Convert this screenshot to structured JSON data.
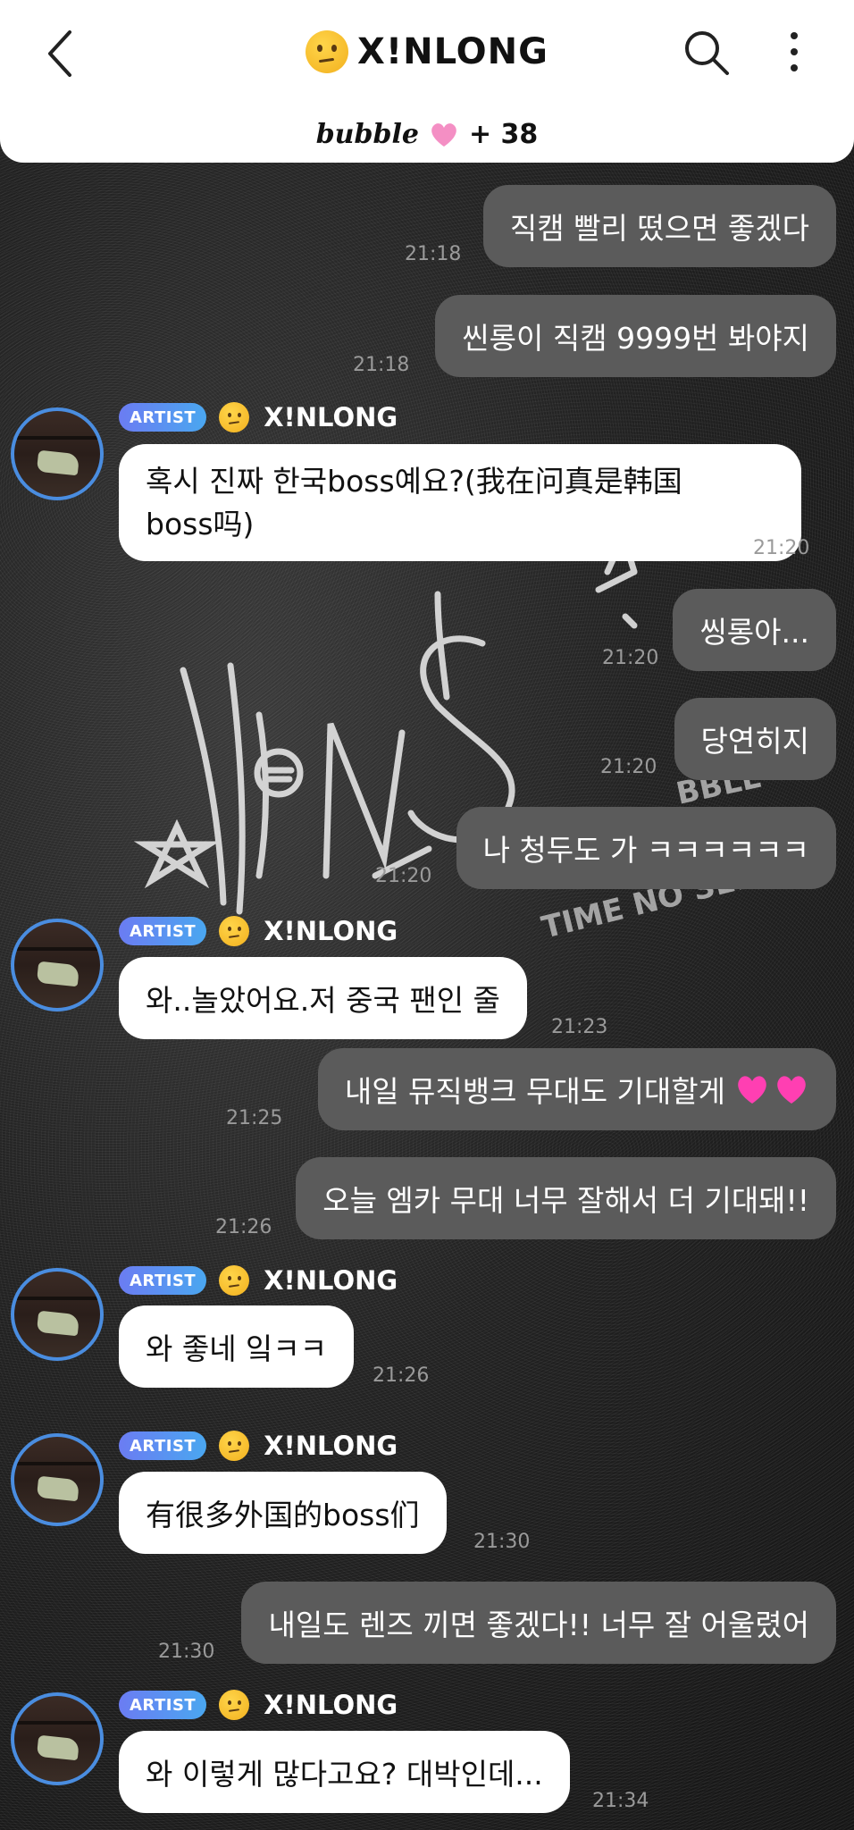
{
  "header": {
    "title": "X!NLONG",
    "brand": "bubble",
    "plus_count": "+ 38"
  },
  "messages": [
    {
      "id": "m1",
      "dir": "out",
      "text": "직캠 빨리 떴으면 좋겠다",
      "time": "21:18"
    },
    {
      "id": "m2",
      "dir": "out",
      "text": "씬롱이 직캠 9999번 봐야지",
      "time": "21:18"
    },
    {
      "id": "m3",
      "dir": "in",
      "badge": "ARTIST",
      "sender": "X!NLONG",
      "line1": "혹시 진짜 한국boss예요?(我在问真是韩国",
      "line2": "boss吗)",
      "time": "21:20"
    },
    {
      "id": "m4",
      "dir": "out",
      "text": "씽롱아...",
      "time": "21:20"
    },
    {
      "id": "m5",
      "dir": "out",
      "text": "당연히지",
      "time": "21:20"
    },
    {
      "id": "m6",
      "dir": "out",
      "text": "나 청두도 가 ㅋㅋㅋㅋㅋㅋ",
      "time": "21:20"
    },
    {
      "id": "m7",
      "dir": "in",
      "badge": "ARTIST",
      "sender": "X!NLONG",
      "text": "와..놀았어요.저 중국 팬인 줄",
      "time": "21:23"
    },
    {
      "id": "m8",
      "dir": "out",
      "text": "내일 뮤직뱅크 무대도 기대할게",
      "time": "21:25"
    },
    {
      "id": "m9",
      "dir": "out",
      "text": "오늘 엠카 무대 너무 잘해서 더 기대돼!!",
      "time": "21:26"
    },
    {
      "id": "m10",
      "dir": "in",
      "badge": "ARTIST",
      "sender": "X!NLONG",
      "text": "와 좋네 잌ㅋㅋ",
      "time": "21:26"
    },
    {
      "id": "m11",
      "dir": "in",
      "badge": "ARTIST",
      "sender": "X!NLONG",
      "text": "有很多外国的boss们",
      "time": "21:30"
    },
    {
      "id": "m12",
      "dir": "out",
      "text": "내일도 렌즈 끼면 좋겠다!! 너무 잘 어울렸어",
      "time": "21:30"
    },
    {
      "id": "m13",
      "dir": "in",
      "badge": "ARTIST",
      "sender": "X!NLONG",
      "text": "와 이렇게 많다고요? 대박인데...",
      "time": "21:34"
    }
  ]
}
